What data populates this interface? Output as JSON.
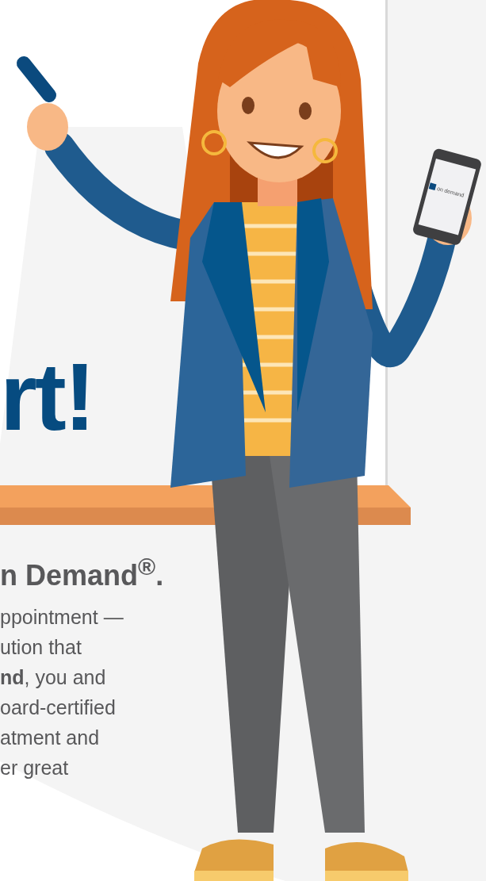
{
  "heading": "rt!",
  "subheading": "n Demand$^{®}$.",
  "body_lines": [
    "ppointment —",
    "ution that",
    "**nd**, you and",
    "oard-certified",
    "atment and",
    "er great"
  ],
  "phone_screen": {
    "label": "on demand"
  }
}
